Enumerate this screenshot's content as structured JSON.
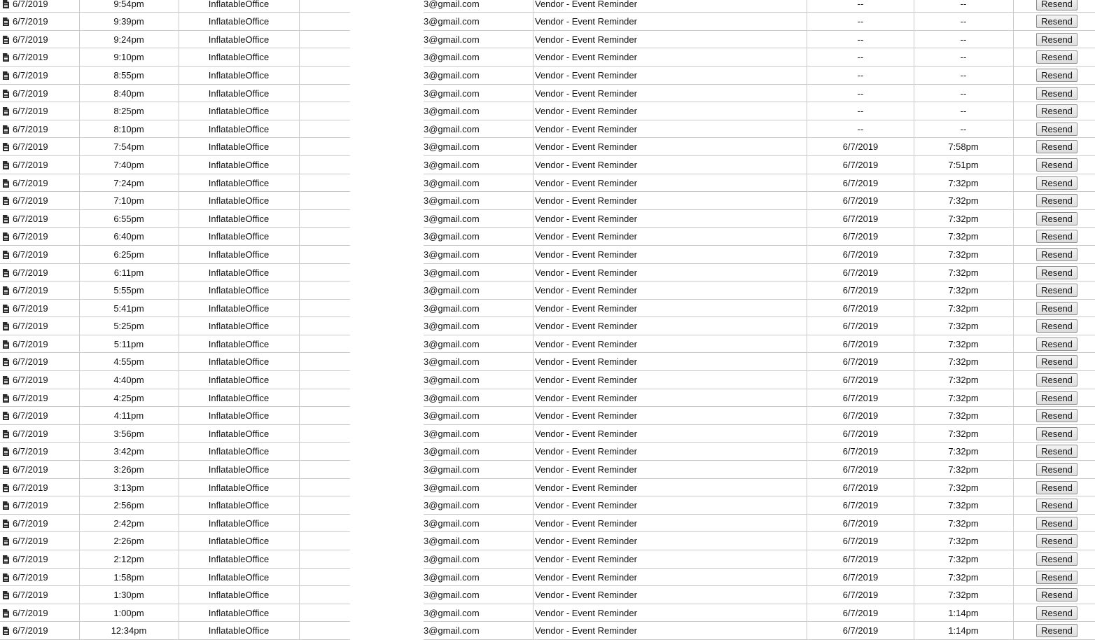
{
  "rows": [
    {
      "date": "6/7/2019",
      "time": "9:54pm",
      "sender": "InflatableOffice",
      "email": "3@gmail.com",
      "subject": "Vendor - Event Reminder",
      "opened_date": "--",
      "opened_time": "--",
      "action": "Resend"
    },
    {
      "date": "6/7/2019",
      "time": "9:39pm",
      "sender": "InflatableOffice",
      "email": "3@gmail.com",
      "subject": "Vendor - Event Reminder",
      "opened_date": "--",
      "opened_time": "--",
      "action": "Resend"
    },
    {
      "date": "6/7/2019",
      "time": "9:24pm",
      "sender": "InflatableOffice",
      "email": "3@gmail.com",
      "subject": "Vendor - Event Reminder",
      "opened_date": "--",
      "opened_time": "--",
      "action": "Resend"
    },
    {
      "date": "6/7/2019",
      "time": "9:10pm",
      "sender": "InflatableOffice",
      "email": "3@gmail.com",
      "subject": "Vendor - Event Reminder",
      "opened_date": "--",
      "opened_time": "--",
      "action": "Resend"
    },
    {
      "date": "6/7/2019",
      "time": "8:55pm",
      "sender": "InflatableOffice",
      "email": "3@gmail.com",
      "subject": "Vendor - Event Reminder",
      "opened_date": "--",
      "opened_time": "--",
      "action": "Resend"
    },
    {
      "date": "6/7/2019",
      "time": "8:40pm",
      "sender": "InflatableOffice",
      "email": "3@gmail.com",
      "subject": "Vendor - Event Reminder",
      "opened_date": "--",
      "opened_time": "--",
      "action": "Resend"
    },
    {
      "date": "6/7/2019",
      "time": "8:25pm",
      "sender": "InflatableOffice",
      "email": "3@gmail.com",
      "subject": "Vendor - Event Reminder",
      "opened_date": "--",
      "opened_time": "--",
      "action": "Resend"
    },
    {
      "date": "6/7/2019",
      "time": "8:10pm",
      "sender": "InflatableOffice",
      "email": "3@gmail.com",
      "subject": "Vendor - Event Reminder",
      "opened_date": "--",
      "opened_time": "--",
      "action": "Resend"
    },
    {
      "date": "6/7/2019",
      "time": "7:54pm",
      "sender": "InflatableOffice",
      "email": "3@gmail.com",
      "subject": "Vendor - Event Reminder",
      "opened_date": "6/7/2019",
      "opened_time": "7:58pm",
      "action": "Resend"
    },
    {
      "date": "6/7/2019",
      "time": "7:40pm",
      "sender": "InflatableOffice",
      "email": "3@gmail.com",
      "subject": "Vendor - Event Reminder",
      "opened_date": "6/7/2019",
      "opened_time": "7:51pm",
      "action": "Resend"
    },
    {
      "date": "6/7/2019",
      "time": "7:24pm",
      "sender": "InflatableOffice",
      "email": "3@gmail.com",
      "subject": "Vendor - Event Reminder",
      "opened_date": "6/7/2019",
      "opened_time": "7:32pm",
      "action": "Resend"
    },
    {
      "date": "6/7/2019",
      "time": "7:10pm",
      "sender": "InflatableOffice",
      "email": "3@gmail.com",
      "subject": "Vendor - Event Reminder",
      "opened_date": "6/7/2019",
      "opened_time": "7:32pm",
      "action": "Resend"
    },
    {
      "date": "6/7/2019",
      "time": "6:55pm",
      "sender": "InflatableOffice",
      "email": "3@gmail.com",
      "subject": "Vendor - Event Reminder",
      "opened_date": "6/7/2019",
      "opened_time": "7:32pm",
      "action": "Resend"
    },
    {
      "date": "6/7/2019",
      "time": "6:40pm",
      "sender": "InflatableOffice",
      "email": "3@gmail.com",
      "subject": "Vendor - Event Reminder",
      "opened_date": "6/7/2019",
      "opened_time": "7:32pm",
      "action": "Resend"
    },
    {
      "date": "6/7/2019",
      "time": "6:25pm",
      "sender": "InflatableOffice",
      "email": "3@gmail.com",
      "subject": "Vendor - Event Reminder",
      "opened_date": "6/7/2019",
      "opened_time": "7:32pm",
      "action": "Resend"
    },
    {
      "date": "6/7/2019",
      "time": "6:11pm",
      "sender": "InflatableOffice",
      "email": "3@gmail.com",
      "subject": "Vendor - Event Reminder",
      "opened_date": "6/7/2019",
      "opened_time": "7:32pm",
      "action": "Resend"
    },
    {
      "date": "6/7/2019",
      "time": "5:55pm",
      "sender": "InflatableOffice",
      "email": "3@gmail.com",
      "subject": "Vendor - Event Reminder",
      "opened_date": "6/7/2019",
      "opened_time": "7:32pm",
      "action": "Resend"
    },
    {
      "date": "6/7/2019",
      "time": "5:41pm",
      "sender": "InflatableOffice",
      "email": "3@gmail.com",
      "subject": "Vendor - Event Reminder",
      "opened_date": "6/7/2019",
      "opened_time": "7:32pm",
      "action": "Resend"
    },
    {
      "date": "6/7/2019",
      "time": "5:25pm",
      "sender": "InflatableOffice",
      "email": "3@gmail.com",
      "subject": "Vendor - Event Reminder",
      "opened_date": "6/7/2019",
      "opened_time": "7:32pm",
      "action": "Resend"
    },
    {
      "date": "6/7/2019",
      "time": "5:11pm",
      "sender": "InflatableOffice",
      "email": "3@gmail.com",
      "subject": "Vendor - Event Reminder",
      "opened_date": "6/7/2019",
      "opened_time": "7:32pm",
      "action": "Resend"
    },
    {
      "date": "6/7/2019",
      "time": "4:55pm",
      "sender": "InflatableOffice",
      "email": "3@gmail.com",
      "subject": "Vendor - Event Reminder",
      "opened_date": "6/7/2019",
      "opened_time": "7:32pm",
      "action": "Resend"
    },
    {
      "date": "6/7/2019",
      "time": "4:40pm",
      "sender": "InflatableOffice",
      "email": "3@gmail.com",
      "subject": "Vendor - Event Reminder",
      "opened_date": "6/7/2019",
      "opened_time": "7:32pm",
      "action": "Resend"
    },
    {
      "date": "6/7/2019",
      "time": "4:25pm",
      "sender": "InflatableOffice",
      "email": "3@gmail.com",
      "subject": "Vendor - Event Reminder",
      "opened_date": "6/7/2019",
      "opened_time": "7:32pm",
      "action": "Resend"
    },
    {
      "date": "6/7/2019",
      "time": "4:11pm",
      "sender": "InflatableOffice",
      "email": "3@gmail.com",
      "subject": "Vendor - Event Reminder",
      "opened_date": "6/7/2019",
      "opened_time": "7:32pm",
      "action": "Resend"
    },
    {
      "date": "6/7/2019",
      "time": "3:56pm",
      "sender": "InflatableOffice",
      "email": "3@gmail.com",
      "subject": "Vendor - Event Reminder",
      "opened_date": "6/7/2019",
      "opened_time": "7:32pm",
      "action": "Resend"
    },
    {
      "date": "6/7/2019",
      "time": "3:42pm",
      "sender": "InflatableOffice",
      "email": "3@gmail.com",
      "subject": "Vendor - Event Reminder",
      "opened_date": "6/7/2019",
      "opened_time": "7:32pm",
      "action": "Resend"
    },
    {
      "date": "6/7/2019",
      "time": "3:26pm",
      "sender": "InflatableOffice",
      "email": "3@gmail.com",
      "subject": "Vendor - Event Reminder",
      "opened_date": "6/7/2019",
      "opened_time": "7:32pm",
      "action": "Resend"
    },
    {
      "date": "6/7/2019",
      "time": "3:13pm",
      "sender": "InflatableOffice",
      "email": "3@gmail.com",
      "subject": "Vendor - Event Reminder",
      "opened_date": "6/7/2019",
      "opened_time": "7:32pm",
      "action": "Resend"
    },
    {
      "date": "6/7/2019",
      "time": "2:56pm",
      "sender": "InflatableOffice",
      "email": "3@gmail.com",
      "subject": "Vendor - Event Reminder",
      "opened_date": "6/7/2019",
      "opened_time": "7:32pm",
      "action": "Resend"
    },
    {
      "date": "6/7/2019",
      "time": "2:42pm",
      "sender": "InflatableOffice",
      "email": "3@gmail.com",
      "subject": "Vendor - Event Reminder",
      "opened_date": "6/7/2019",
      "opened_time": "7:32pm",
      "action": "Resend"
    },
    {
      "date": "6/7/2019",
      "time": "2:26pm",
      "sender": "InflatableOffice",
      "email": "3@gmail.com",
      "subject": "Vendor - Event Reminder",
      "opened_date": "6/7/2019",
      "opened_time": "7:32pm",
      "action": "Resend"
    },
    {
      "date": "6/7/2019",
      "time": "2:12pm",
      "sender": "InflatableOffice",
      "email": "3@gmail.com",
      "subject": "Vendor - Event Reminder",
      "opened_date": "6/7/2019",
      "opened_time": "7:32pm",
      "action": "Resend"
    },
    {
      "date": "6/7/2019",
      "time": "1:58pm",
      "sender": "InflatableOffice",
      "email": "3@gmail.com",
      "subject": "Vendor - Event Reminder",
      "opened_date": "6/7/2019",
      "opened_time": "7:32pm",
      "action": "Resend"
    },
    {
      "date": "6/7/2019",
      "time": "1:30pm",
      "sender": "InflatableOffice",
      "email": "3@gmail.com",
      "subject": "Vendor - Event Reminder",
      "opened_date": "6/7/2019",
      "opened_time": "7:32pm",
      "action": "Resend"
    },
    {
      "date": "6/7/2019",
      "time": "1:00pm",
      "sender": "InflatableOffice",
      "email": "3@gmail.com",
      "subject": "Vendor - Event Reminder",
      "opened_date": "6/7/2019",
      "opened_time": "1:14pm",
      "action": "Resend"
    },
    {
      "date": "6/7/2019",
      "time": "12:34pm",
      "sender": "InflatableOffice",
      "email": "3@gmail.com",
      "subject": "Vendor - Event Reminder",
      "opened_date": "6/7/2019",
      "opened_time": "1:14pm",
      "action": "Resend"
    }
  ],
  "colors": {
    "grid_line": "#c9c9c9",
    "text": "#111111",
    "button_border": "#8c8c8c"
  },
  "icons": {
    "row_icon": "document-icon"
  }
}
